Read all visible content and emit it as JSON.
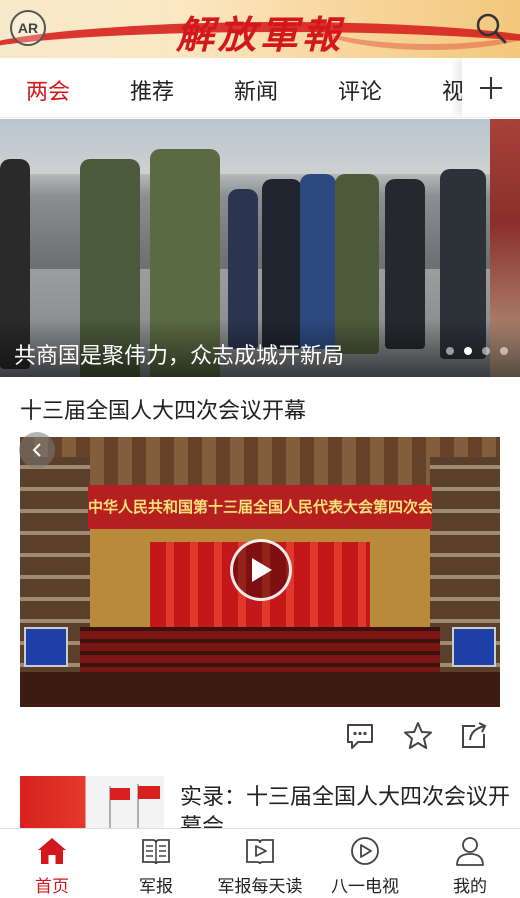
{
  "header": {
    "ar_label": "AR",
    "logo_text": "解放軍報"
  },
  "tabs": [
    {
      "label": "两会",
      "active": true
    },
    {
      "label": "推荐"
    },
    {
      "label": "新闻"
    },
    {
      "label": "评论"
    },
    {
      "label": "视"
    }
  ],
  "banner": {
    "caption": "共商国是聚伟力，众志成城开新局",
    "slide_count": 4,
    "active_slide": 2
  },
  "article1": {
    "title": "十三届全国人大四次会议开幕",
    "video_banner_text": "中华人民共和国第十三届全国人民代表大会第四次会议"
  },
  "article2": {
    "title": "实录：十三届全国人大四次会议开幕会"
  },
  "bottom_nav": [
    {
      "label": "首页",
      "icon": "home-icon",
      "active": true
    },
    {
      "label": "军报",
      "icon": "newspaper-icon"
    },
    {
      "label": "军报每天读",
      "icon": "audio-book-icon"
    },
    {
      "label": "八一电视",
      "icon": "tv-play-icon"
    },
    {
      "label": "我的",
      "icon": "user-icon"
    }
  ],
  "colors": {
    "accent": "#d2181c",
    "text": "#222222"
  }
}
